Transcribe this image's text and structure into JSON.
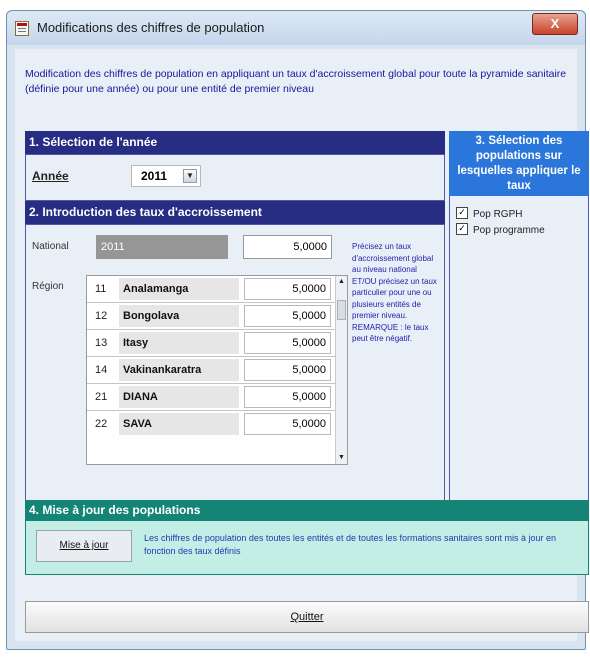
{
  "window": {
    "title": "Modifications des chiffres de population",
    "close_glyph": "X"
  },
  "description": "Modification des chiffres de population en appliquant un taux d'accroissement global pour toute la pyramide sanitaire (définie pour une année) ou pour une entité de premier niveau",
  "section1": {
    "header": "1. Sélection de l'année",
    "year_label": "Année",
    "year_value": "2011"
  },
  "section2": {
    "header": "2. Introduction des taux d'accroissement",
    "national_label": "National",
    "national_code": "2011",
    "national_rate": "5,0000",
    "region_label": "Région",
    "regions": [
      {
        "code": "11",
        "name": "Analamanga",
        "rate": "5,0000"
      },
      {
        "code": "12",
        "name": "Bongolava",
        "rate": "5,0000"
      },
      {
        "code": "13",
        "name": "Itasy",
        "rate": "5,0000"
      },
      {
        "code": "14",
        "name": "Vakinankaratra",
        "rate": "5,0000"
      },
      {
        "code": "21",
        "name": "DIANA",
        "rate": "5,0000"
      },
      {
        "code": "22",
        "name": "SAVA",
        "rate": "5,0000"
      }
    ],
    "help_text": "Précisez un taux d'accroissement global au niveau national ET/OU précisez un taux particulier pour une ou plusieurs entités de premier niveau. REMARQUE : le taux peut être négatif."
  },
  "section3": {
    "header": "3. Sélection des populations sur lesquelles appliquer le taux",
    "options": [
      {
        "label": "Pop RGPH",
        "checked": true
      },
      {
        "label": "Pop programme",
        "checked": true
      }
    ]
  },
  "section4": {
    "header": "4. Mise à jour des populations",
    "button_label": "Mise à jour",
    "text": "Les chiffres de population des toutes les entités et de toutes les formations sanitaires sont mis à jour en fonction des taux définis"
  },
  "quit_label": "Quitter",
  "colors": {
    "section_header": "#262d83",
    "section3_header": "#2b76da",
    "section4_header": "#148477",
    "section4_body": "#c3eee6",
    "text_blue": "#17179a"
  },
  "icons": {
    "app": "form-icon",
    "close": "close-icon",
    "combo": "chevron-down-icon",
    "scroll_up": "scroll-up-icon",
    "scroll_down": "scroll-down-icon",
    "checkbox": "checkbox-checked-icon"
  }
}
